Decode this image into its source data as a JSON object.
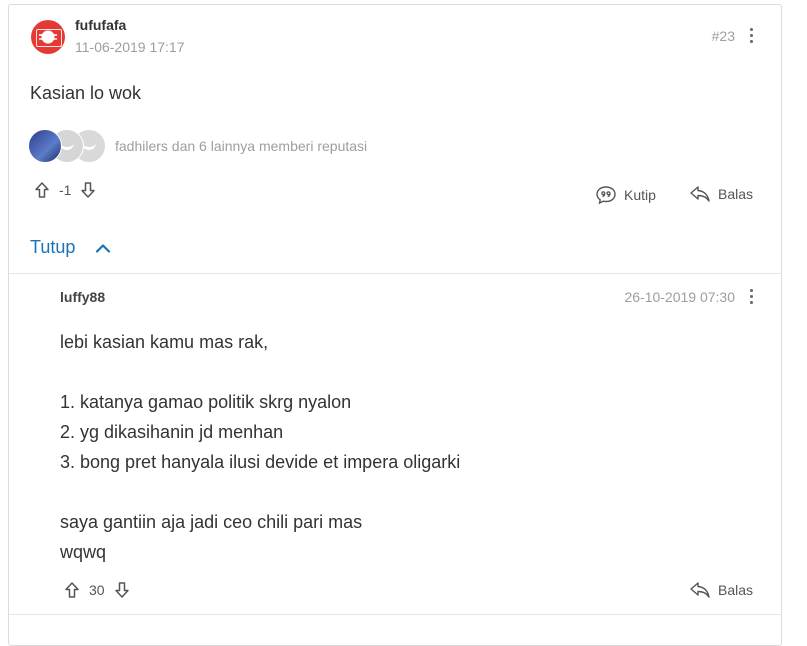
{
  "post": {
    "username": "fufufafa",
    "date": "11-06-2019 17:17",
    "number": "#23",
    "body": "Kasian lo wok",
    "reputation_text": "fadhilers dan 6 lainnya memberi reputasi",
    "vote_count": "-1",
    "quote_label": "Kutip",
    "reply_label": "Balas"
  },
  "toggle": {
    "label": "Tutup"
  },
  "reply": {
    "username": "luffy88",
    "date": "26-10-2019 07:30",
    "body_lines": [
      "lebi kasian kamu mas rak,",
      "",
      "1. katanya gamao politik skrg nyalon",
      "2. yg dikasihanin jd menhan",
      "3. bong pret hanyala ilusi devide et impera oligarki",
      "",
      "saya gantiin aja jadi ceo chili pari mas",
      "wqwq"
    ],
    "vote_count": "30",
    "reply_label": "Balas"
  },
  "colors": {
    "accent": "#1a73b5",
    "muted": "#9e9e9e",
    "avatar_red": "#e53935"
  }
}
